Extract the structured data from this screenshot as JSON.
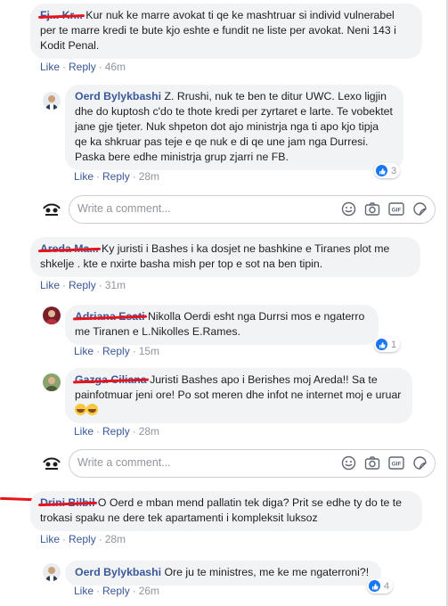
{
  "actions": {
    "like": "Like",
    "reply": "Reply",
    "separator": "·"
  },
  "write_placeholder": "Write a comment...",
  "comments": [
    {
      "name": "Fj... Kr...",
      "text": "Kur nuk ke marre avokat ti qe ke mashtruar si individ vulnerabel per te marre kredi te bute kjo eshte e fundit ne liste per avokat. Neni 143 i Kodit Penal.",
      "time": "46m"
    },
    {
      "name": "Oerd Bylykbashi",
      "text": "Z. Rrushi, nuk te ben te ditur UWC. Lexo ligjin dhe do kuptosh c'do te thote kredi per zyrtaret e larte. Te vobektet jane gje tjeter. Nuk shpeton dot ajo ministrja nga ti apo kjo tipja qe ka shkruar pas teje e qe nuk e di qe une jam nga Durresi. Paska bere edhe ministrja grup zjarri ne FB.",
      "time": "28m",
      "reactions": "3"
    },
    {
      "name": "Areda Ma...",
      "text": "Ky juristi i Bashes i ka dosjet ne bashkine e Tiranes plot me shkelje . kte e nxirte basha mish per top e sot na ben tipin.",
      "time": "31m"
    },
    {
      "name": "Adriana Esati",
      "text": "Nikolla Oerdi esht nga Durrsi mos e ngaterro me Tiranen e L.Nikolles E.Rames.",
      "time": "15m",
      "reactions": "1"
    },
    {
      "name": "Gazga Ciliana",
      "text": "Juristi Bashes apo i Berishes moj Areda!! Sa te painfotmuar jeni ore! Po sot meren dhe infot ne internet moj e uruar",
      "time": "28m"
    },
    {
      "name": "Drini Bilbil",
      "text": "O Oerd e mban mend pallatin tek diga? Prit se edhe ty do te te trokasi spaku ne dere tek apartamenti i kompleksit luksoz",
      "time": "28m"
    },
    {
      "name": "Oerd Bylykbashi",
      "text": "Ore ju te ministres, me ke me ngaterroni?!",
      "time": "26m",
      "reactions": "4"
    }
  ],
  "colors": {
    "link": "#385898",
    "bubble": "#f2f3f5",
    "meta": "#90949c",
    "like": "#1877f2",
    "redaction": "#e8141c"
  },
  "icons": [
    "thumbs-up-icon",
    "smiley-icon",
    "camera-icon",
    "gif-icon",
    "sticker-icon"
  ]
}
